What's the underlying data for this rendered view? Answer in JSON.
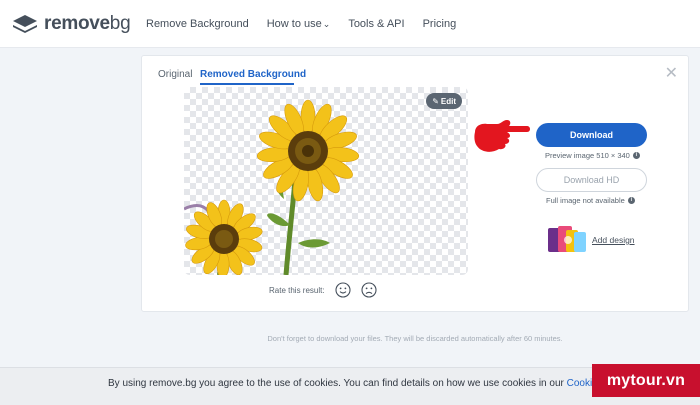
{
  "nav": {
    "logo_text_1": "remove",
    "logo_text_2": "bg",
    "links": [
      "Remove Background",
      "How to use",
      "Tools & API",
      "Pricing"
    ]
  },
  "tabs": {
    "original": "Original",
    "removed": "Removed Background"
  },
  "preview": {
    "edit_label": "Edit"
  },
  "rating": {
    "label": "Rate this result:"
  },
  "download": {
    "button_label": "Download",
    "preview_info": "Preview image 510 × 340",
    "hd_button_label": "Download HD",
    "hd_info": "Full image not available"
  },
  "design": {
    "link_label": "Add design"
  },
  "notice": "Don't forget to download your files. They will be discarded automatically after 60 minutes.",
  "cookie": {
    "text": "By using remove.bg you agree to the use of cookies. You can find details on how we use cookies in our ",
    "link": "Cookie Policy"
  },
  "watermark": "mytour.vn",
  "colors": {
    "accent": "#1f64c8",
    "watermark_red": "#c8102e"
  }
}
